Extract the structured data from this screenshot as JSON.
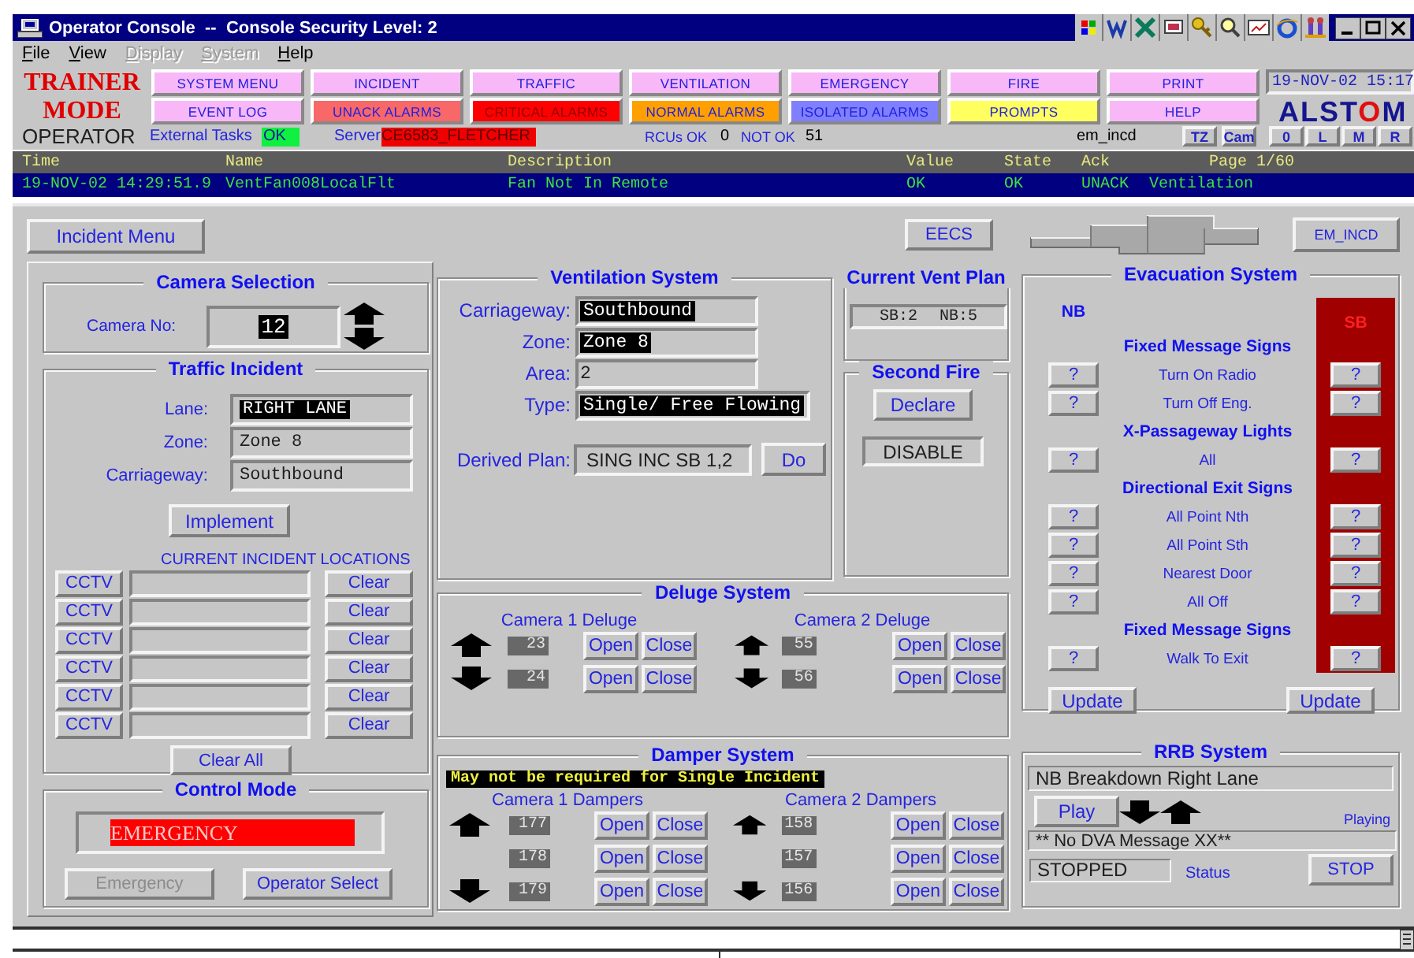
{
  "window": {
    "title": "Operator Console  --  Console Security Level: 2"
  },
  "menu": [
    {
      "label": "File",
      "disabled": false
    },
    {
      "label": "View",
      "disabled": false
    },
    {
      "label": "Display",
      "disabled": true
    },
    {
      "label": "System",
      "disabled": true
    },
    {
      "label": "Help",
      "disabled": false
    }
  ],
  "mode": [
    "TRAINER",
    "MODE"
  ],
  "nav_buttons": [
    {
      "label": "SYSTEM MENU",
      "color": "#f8b8f8"
    },
    {
      "label": "INCIDENT",
      "color": "#f8b8f8"
    },
    {
      "label": "TRAFFIC",
      "color": "#f8b8f8"
    },
    {
      "label": "VENTILATION",
      "color": "#f8b8f8"
    },
    {
      "label": "EMERGENCY",
      "color": "#f8b8f8"
    },
    {
      "label": "FIRE",
      "color": "#f8b8f8"
    },
    {
      "label": "PRINT",
      "color": "#f8b8f8"
    },
    {
      "label": "EVENT LOG",
      "color": "#f8b8f8"
    },
    {
      "label": "UNACK ALARMS",
      "color": "#f86868"
    },
    {
      "label": "CRITICAL ALARMS",
      "color": "#ff0000"
    },
    {
      "label": "NORMAL ALARMS",
      "color": "#ffa000"
    },
    {
      "label": "ISOLATED ALARMS",
      "color": "#8080ff"
    },
    {
      "label": "PROMPTS",
      "color": "#ffff60"
    },
    {
      "label": "HELP",
      "color": "#f8b8f8"
    }
  ],
  "clock": "19-NOV-02 15:17",
  "logo": "ALSTOM",
  "status_line": {
    "role": "OPERATOR",
    "external_tasks_label": "External Tasks",
    "external_tasks_value": "OK",
    "server_label": "Server",
    "server_value": "CE6583_FLETCHER",
    "rcus_ok_label": "RCUs OK",
    "rcus_ok_value": "0",
    "not_ok_label": "NOT OK",
    "not_ok_value": "51",
    "display_name": "em_incd"
  },
  "small_buttons": [
    "TZ",
    "Cam"
  ],
  "view_buttons": [
    "0",
    "L",
    "M",
    "R"
  ],
  "alarm_table": {
    "columns": [
      "Time",
      "Name",
      "Description",
      "Value",
      "State",
      "Ack"
    ],
    "page": "Page 1/60",
    "rows": [
      {
        "selected": true,
        "cells": [
          "19-NOV-02 14:29:51.9",
          "VentFan008LocalFlt",
          "Fan Not In Remote",
          "OK",
          "OK",
          "UNACK",
          "Ventilation"
        ]
      }
    ]
  },
  "header_buttons": {
    "incident_menu": "Incident Menu",
    "eecs": "EECS",
    "em_incd": "EM_INCD"
  },
  "camera_selection": {
    "title": "Camera Selection",
    "label": "Camera No:",
    "value": "12"
  },
  "traffic_incident": {
    "title": "Traffic Incident",
    "fields": [
      {
        "label": "Lane:",
        "value": "RIGHT LANE",
        "highlighted": true
      },
      {
        "label": "Zone:",
        "value": "Zone 8",
        "highlighted": false
      },
      {
        "label": "Carriageway:",
        "value": "Southbound",
        "highlighted": false
      }
    ],
    "implement": "Implement",
    "locations_title": "CURRENT INCIDENT LOCATIONS",
    "locations": [
      {
        "cctv": "CCTV",
        "clear": "Clear"
      },
      {
        "cctv": "CCTV",
        "clear": "Clear"
      },
      {
        "cctv": "CCTV",
        "clear": "Clear"
      },
      {
        "cctv": "CCTV",
        "clear": "Clear"
      },
      {
        "cctv": "CCTV",
        "clear": "Clear"
      },
      {
        "cctv": "CCTV",
        "clear": "Clear"
      }
    ],
    "clear_all": "Clear All"
  },
  "control_mode": {
    "title": "Control Mode",
    "value": "EMERGENCY",
    "buttons": [
      {
        "label": "Emergency",
        "disabled": true
      },
      {
        "label": "Operator Select",
        "disabled": false
      }
    ]
  },
  "ventilation": {
    "title": "Ventilation System",
    "fields": [
      {
        "label": "Carriageway:",
        "value": "Southbound",
        "highlighted": true
      },
      {
        "label": "Zone:",
        "value": "Zone 8",
        "highlighted": true
      },
      {
        "label": "Area:",
        "value": "2",
        "highlighted": false
      },
      {
        "label": "Type:",
        "value": "Single/ Free Flowing",
        "highlighted": true
      }
    ],
    "derived_plan_label": "Derived Plan:",
    "derived_plan": "SING INC SB 1,2",
    "do": "Do"
  },
  "vent_plan": {
    "title": "Current Vent Plan",
    "sb": "SB:2",
    "nb": "NB:5"
  },
  "second_fire": {
    "title": "Second Fire",
    "declare": "Declare",
    "status": "DISABLE"
  },
  "deluge": {
    "title": "Deluge System",
    "cameras": [
      {
        "title": "Camera 1 Deluge",
        "rows": [
          {
            "kind": "up",
            "id": "23",
            "open": "Open",
            "close": "Close"
          },
          {
            "kind": "down",
            "id": "24",
            "open": "Open",
            "close": "Close"
          }
        ]
      },
      {
        "title": "Camera 2 Deluge",
        "rows": [
          {
            "kind": "up",
            "id": "55",
            "open": "Open",
            "close": "Close"
          },
          {
            "kind": "down",
            "id": "56",
            "open": "Open",
            "close": "Close"
          }
        ]
      }
    ]
  },
  "damper": {
    "title": "Damper System",
    "warning": "May not be required for Single Incident",
    "cameras": [
      {
        "title": "Camera 1 Dampers",
        "rows": [
          {
            "kind": "up",
            "id": "177",
            "open": "Open",
            "close": "Close"
          },
          {
            "kind": "plain",
            "id": "178",
            "open": "Open",
            "close": "Close"
          },
          {
            "kind": "down",
            "id": "179",
            "open": "Open",
            "close": "Close"
          }
        ]
      },
      {
        "title": "Camera 2 Dampers",
        "rows": [
          {
            "kind": "up",
            "id": "158",
            "open": "Open",
            "close": "Close"
          },
          {
            "kind": "plain",
            "id": "157",
            "open": "Open",
            "close": "Close"
          },
          {
            "kind": "down",
            "id": "156",
            "open": "Open",
            "close": "Close"
          }
        ]
      }
    ]
  },
  "evacuation": {
    "title": "Evacuation System",
    "nb_label": "NB",
    "sb_label": "SB",
    "rows": [
      {
        "kind": "heading",
        "text": "Fixed Message Signs"
      },
      {
        "kind": "item",
        "text": "Turn On Radio",
        "nb": "?",
        "sb": "?"
      },
      {
        "kind": "item",
        "text": "Turn Off Eng.",
        "nb": "?",
        "sb": "?"
      },
      {
        "kind": "heading",
        "text": "X-Passageway Lights"
      },
      {
        "kind": "item",
        "text": "All",
        "nb": "?",
        "sb": "?"
      },
      {
        "kind": "heading",
        "text": "Directional Exit Signs"
      },
      {
        "kind": "item",
        "text": "All Point Nth",
        "nb": "?",
        "sb": "?"
      },
      {
        "kind": "item",
        "text": "All Point Sth",
        "nb": "?",
        "sb": "?"
      },
      {
        "kind": "item",
        "text": "Nearest Door",
        "nb": "?",
        "sb": "?"
      },
      {
        "kind": "item",
        "text": "All Off",
        "nb": "?",
        "sb": "?"
      },
      {
        "kind": "heading",
        "text": "Fixed Message Signs"
      },
      {
        "kind": "item",
        "text": "Walk To Exit",
        "nb": "?",
        "sb": "?"
      }
    ],
    "updates": [
      "Update",
      "Update"
    ]
  },
  "rrb": {
    "title": "RRB System",
    "message": "NB Breakdown Right Lane",
    "play": "Play",
    "playing": "Playing",
    "dva": "** No DVA Message XX**",
    "status_value": "STOPPED",
    "status_label": "Status",
    "stop": "STOP"
  }
}
